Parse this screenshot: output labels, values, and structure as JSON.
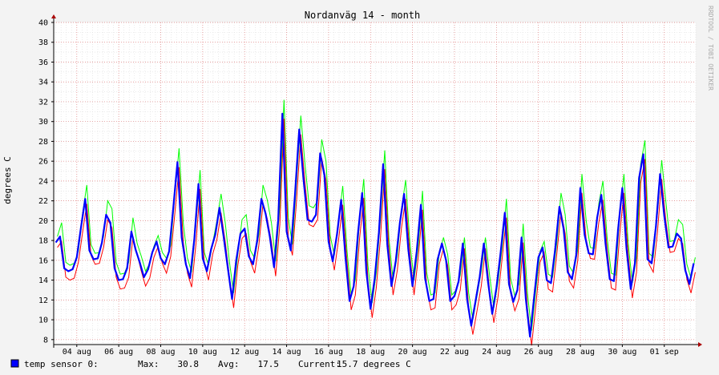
{
  "chart_data": {
    "type": "line",
    "title": "Nordanväg 14 - month",
    "ylabel": "degrees C",
    "xlabel": "",
    "ylim": [
      7.5,
      40
    ],
    "y_ticks": [
      8,
      10,
      12,
      14,
      16,
      18,
      20,
      22,
      24,
      26,
      28,
      30,
      32,
      34,
      36,
      38,
      40
    ],
    "x_tick_labels": [
      "04 aug",
      "06 aug",
      "08 aug",
      "10 aug",
      "12 aug",
      "14 aug",
      "16 aug",
      "18 aug",
      "20 aug",
      "22 aug",
      "24 aug",
      "26 aug",
      "28 aug",
      "30 aug",
      "01 sep"
    ],
    "x_ticks_day": [
      4,
      6,
      8,
      10,
      12,
      14,
      16,
      18,
      20,
      22,
      24,
      26,
      28,
      30,
      32
    ],
    "xlim_day": [
      2.9,
      33.5
    ],
    "grid": true,
    "watermark": "RRDTOOL / TOBI OETIKER",
    "series": [
      {
        "name": "temp sensor 0:",
        "color": "#0000ff",
        "x_day": [
          3.0,
          3.2,
          3.4,
          3.6,
          3.8,
          4.0,
          4.2,
          4.4,
          4.6,
          4.8,
          5.0,
          5.2,
          5.4,
          5.6,
          5.8,
          6.0,
          6.2,
          6.4,
          6.6,
          6.8,
          7.0,
          7.2,
          7.4,
          7.6,
          7.8,
          8.0,
          8.2,
          8.4,
          8.6,
          8.8,
          9.0,
          9.2,
          9.4,
          9.6,
          9.8,
          10.0,
          10.2,
          10.4,
          10.6,
          10.8,
          11.0,
          11.2,
          11.4,
          11.6,
          11.8,
          12.0,
          12.2,
          12.4,
          12.6,
          12.8,
          13.0,
          13.2,
          13.4,
          13.6,
          13.8,
          14.0,
          14.2,
          14.4,
          14.6,
          14.8,
          15.0,
          15.2,
          15.4,
          15.6,
          15.8,
          16.0,
          16.2,
          16.4,
          16.6,
          16.8,
          17.0,
          17.2,
          17.4,
          17.6,
          17.8,
          18.0,
          18.2,
          18.4,
          18.6,
          18.8,
          19.0,
          19.2,
          19.4,
          19.6,
          19.8,
          20.0,
          20.2,
          20.4,
          20.6,
          20.8,
          21.0,
          21.2,
          21.4,
          21.6,
          21.8,
          22.0,
          22.2,
          22.4,
          22.6,
          22.8,
          23.0,
          23.2,
          23.4,
          23.6,
          23.8,
          24.0,
          24.2,
          24.4,
          24.6,
          24.8,
          25.0,
          25.2,
          25.4,
          25.6,
          25.8,
          26.0,
          26.2,
          26.4,
          26.6,
          26.8,
          27.0,
          27.2,
          27.4,
          27.6,
          27.8,
          28.0,
          28.2,
          28.4,
          28.6,
          28.8,
          29.0,
          29.2,
          29.4,
          29.6,
          29.8,
          30.0,
          30.2,
          30.4,
          30.6,
          30.8,
          31.0,
          31.2,
          31.4,
          31.6,
          31.8,
          32.0,
          32.2,
          32.4,
          32.6,
          32.8,
          33.0,
          33.2,
          33.4
        ],
        "values": [
          17.8,
          18.4,
          15.2,
          14.9,
          15.1,
          16.3,
          19.3,
          22.2,
          17.0,
          16.1,
          16.2,
          17.8,
          20.6,
          19.8,
          15.2,
          14.0,
          14.1,
          15.2,
          18.9,
          17.1,
          15.8,
          14.3,
          15.1,
          16.8,
          17.9,
          16.2,
          15.6,
          16.9,
          21.3,
          25.9,
          18.3,
          15.6,
          14.2,
          18.1,
          23.7,
          16.2,
          14.9,
          17.1,
          18.6,
          21.3,
          18.4,
          15.2,
          12.1,
          16.0,
          18.7,
          19.2,
          16.4,
          15.6,
          18.0,
          22.2,
          20.7,
          18.4,
          15.3,
          20.1,
          30.8,
          18.9,
          17.0,
          22.6,
          29.2,
          24.3,
          20.1,
          19.9,
          20.6,
          26.8,
          24.6,
          17.9,
          15.9,
          18.6,
          22.1,
          16.4,
          11.9,
          13.4,
          18.7,
          22.8,
          14.9,
          11.1,
          14.2,
          18.8,
          25.7,
          17.6,
          13.4,
          15.9,
          19.8,
          22.7,
          17.1,
          13.4,
          16.9,
          21.6,
          14.2,
          11.9,
          12.1,
          16.1,
          17.7,
          16.0,
          11.9,
          12.4,
          13.9,
          17.7,
          12.1,
          9.4,
          11.8,
          14.3,
          17.7,
          13.8,
          10.6,
          13.2,
          16.8,
          20.8,
          13.6,
          11.8,
          13.0,
          18.3,
          12.1,
          8.3,
          12.3,
          16.3,
          17.3,
          14.0,
          13.7,
          17.1,
          21.4,
          19.2,
          14.8,
          14.1,
          16.5,
          23.3,
          18.6,
          16.7,
          16.6,
          20.3,
          22.6,
          17.7,
          14.1,
          13.9,
          19.1,
          23.3,
          17.2,
          13.1,
          15.7,
          24.3,
          26.7,
          16.1,
          15.7,
          19.4,
          24.7,
          20.5,
          17.3,
          17.4,
          18.7,
          18.2,
          15.0,
          13.6,
          15.7
        ]
      }
    ],
    "envelope": {
      "max_color": "#00ff00",
      "min_color": "#ff0000"
    },
    "legend": {
      "label": "temp sensor 0:",
      "color": "#0000ff",
      "max_label": "Max:",
      "max_value": "30.8",
      "avg_label": "Avg:",
      "avg_value": "17.5",
      "current_label": "Current:",
      "current_value": "15.7 degrees C"
    }
  }
}
